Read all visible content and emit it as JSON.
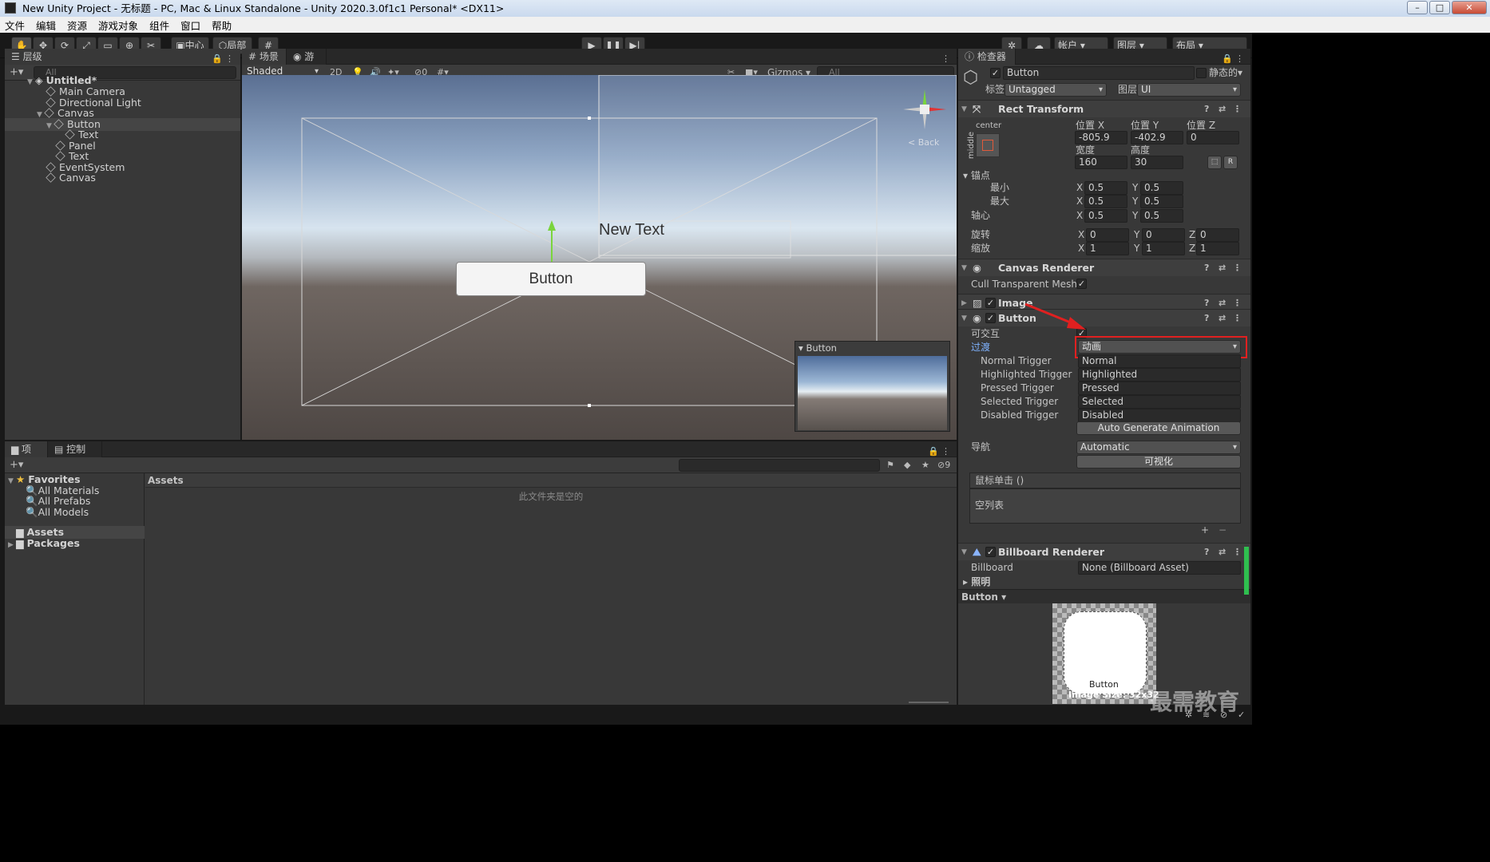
{
  "window": {
    "title": "New Unity Project - 无标题 - PC, Mac & Linux Standalone - Unity 2020.3.0f1c1 Personal* <DX11>"
  },
  "menu": [
    "文件",
    "编辑",
    "资源",
    "游戏对象",
    "组件",
    "窗口",
    "帮助"
  ],
  "toolbar": {
    "pivot_center": "中心",
    "pivot_local": "局部",
    "account": "帐户",
    "layers": "图层",
    "layout": "布局"
  },
  "hierarchy": {
    "tab": "层级",
    "search_placeholder": "All",
    "items": [
      {
        "label": "Untitled*"
      },
      {
        "label": "Main Camera"
      },
      {
        "label": "Directional Light"
      },
      {
        "label": "Canvas"
      },
      {
        "label": "Button"
      },
      {
        "label": "Text"
      },
      {
        "label": "Panel"
      },
      {
        "label": "Text"
      },
      {
        "label": "EventSystem"
      },
      {
        "label": "Canvas"
      }
    ]
  },
  "scene": {
    "tabs": [
      "场景",
      "游戏"
    ],
    "shading": "Shaded",
    "mode2d": "2D",
    "hidden_count": "0",
    "gizmos": "Gizmos",
    "search_placeholder": "All",
    "new_text": "New Text",
    "button_text": "Button",
    "back_label": "< Back",
    "preview_title": "Button"
  },
  "project": {
    "tabs": [
      "项目",
      "控制台"
    ],
    "hidden_count": "9",
    "favorites": {
      "label": "Favorites",
      "items": [
        "All Materials",
        "All Prefabs",
        "All Models"
      ]
    },
    "folders": [
      "Assets",
      "Packages"
    ],
    "breadcrumb": "Assets",
    "empty_message": "此文件夹是空的"
  },
  "inspector": {
    "tab": "检查器",
    "object_name": "Button",
    "static_label": "静态的",
    "tag_label": "标签",
    "tag_value": "Untagged",
    "layer_label": "图层",
    "layer_value": "UI",
    "rect_transform": {
      "title": "Rect Transform",
      "anchor_h": "center",
      "anchor_v": "middle",
      "labels": {
        "pos_x": "位置 X",
        "pos_y": "位置 Y",
        "pos_z": "位置 Z",
        "width": "宽度",
        "height": "高度",
        "anchors": "锚点",
        "min": "最小",
        "max": "最大",
        "pivot": "轴心",
        "rotation": "旋转",
        "scale": "缩放"
      },
      "pos_x": "-805.9",
      "pos_y": "-402.9",
      "pos_z": "0",
      "width": "160",
      "height": "30",
      "min_x": "0.5",
      "min_y": "0.5",
      "max_x": "0.5",
      "max_y": "0.5",
      "pivot_x": "0.5",
      "pivot_y": "0.5",
      "rot_x": "0",
      "rot_y": "0",
      "rot_z": "0",
      "scale_x": "1",
      "scale_y": "1",
      "scale_z": "1"
    },
    "canvas_renderer": {
      "title": "Canvas Renderer",
      "cull_label": "Cull Transparent Mesh"
    },
    "image": {
      "title": "Image"
    },
    "button": {
      "title": "Button",
      "interactable_label": "可交互",
      "transition_label": "过渡",
      "transition_value": "动画",
      "triggers": [
        {
          "label": "Normal Trigger",
          "value": "Normal"
        },
        {
          "label": "Highlighted Trigger",
          "value": "Highlighted"
        },
        {
          "label": "Pressed Trigger",
          "value": "Pressed"
        },
        {
          "label": "Selected Trigger",
          "value": "Selected"
        },
        {
          "label": "Disabled Trigger",
          "value": "Disabled"
        }
      ],
      "auto_generate": "Auto Generate Animation",
      "nav_label": "导航",
      "nav_value": "Automatic",
      "visualize": "可视化",
      "onclick_title": "鼠标单击 ()",
      "empty_list": "空列表"
    },
    "billboard": {
      "title": "Billboard Renderer",
      "billboard_label": "Billboard",
      "billboard_value": "None (Billboard Asset)",
      "lighting": "照明"
    },
    "preview": {
      "title": "Button",
      "image_name": "Button",
      "image_size": "Image Size: 32x32"
    }
  },
  "watermark": "最需教育",
  "colors": {
    "accent": "#3d8bfd",
    "highlight_red": "#e02020",
    "panel": "#383838"
  }
}
